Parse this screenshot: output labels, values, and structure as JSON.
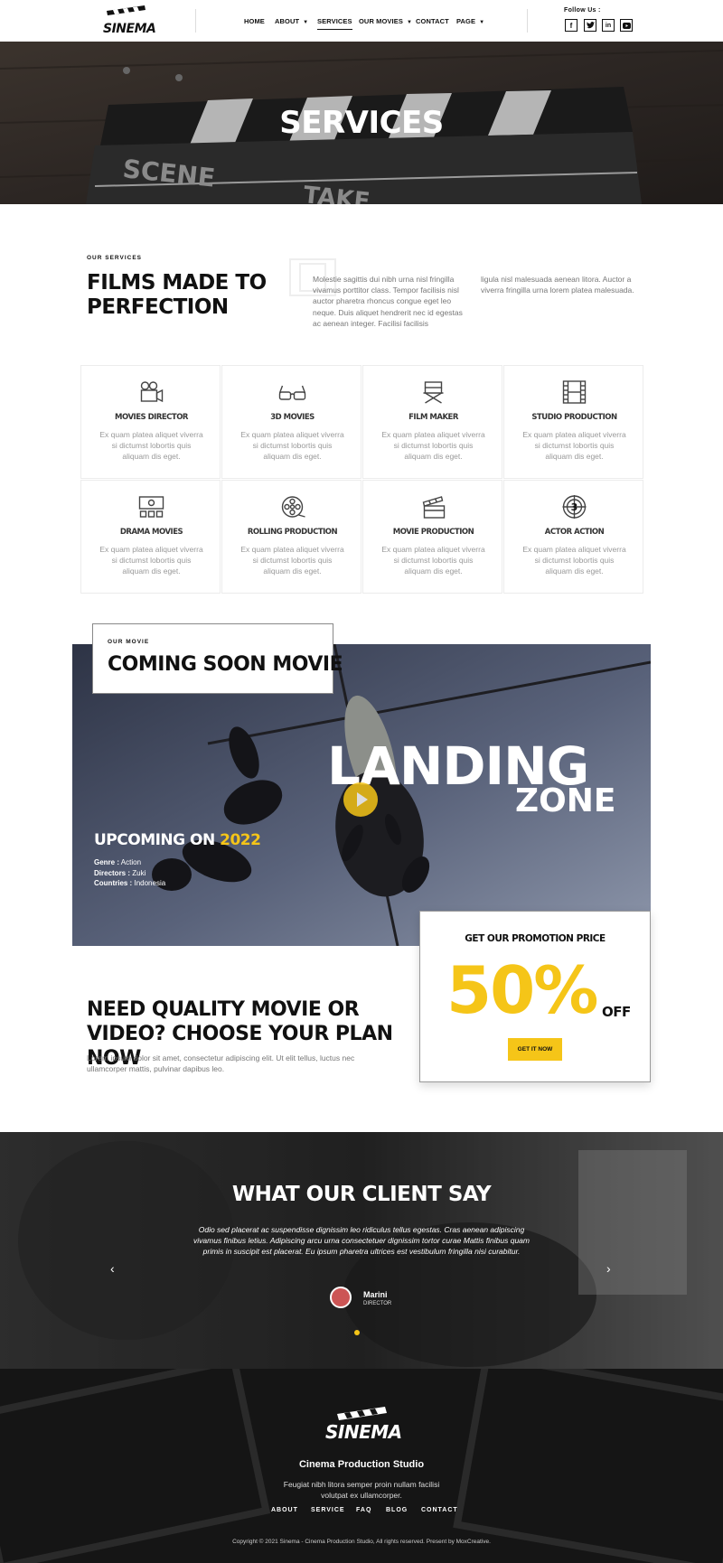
{
  "header": {
    "logo": "SINEMA",
    "nav": [
      {
        "label": "HOME"
      },
      {
        "label": "ABOUT"
      },
      {
        "label": "SERVICES"
      },
      {
        "label": "OUR MOVIES"
      },
      {
        "label": "CONTACT"
      },
      {
        "label": "PAGE"
      }
    ],
    "follow_label": "Follow Us :",
    "social": [
      "facebook-icon",
      "twitter-icon",
      "linkedin-icon",
      "youtube-icon"
    ]
  },
  "hero": {
    "title": "SERVICES"
  },
  "intro": {
    "tag": "OUR SERVICES",
    "title": "FILMS MADE TO PERFECTION",
    "p1": "Molestie sagittis dui nibh urna nisl fringilla vivamus porttitor class. Tempor facilisis nisl auctor pharetra rhoncus congue eget leo neque. Duis aliquet hendrerit nec id egestas ac aenean integer. Facilisi facilisis",
    "p2": "ligula nisl malesuada aenean litora. Auctor a viverra fringilla urna lorem platea malesuada."
  },
  "services": [
    {
      "title": "MOVIES DIRECTOR",
      "desc": "Ex quam platea aliquet viverra si dictumst lobortis quis aliquam dis eget.",
      "icon": "movie-camera-icon"
    },
    {
      "title": "3D MOVIES",
      "desc": "Ex quam platea aliquet viverra si dictumst lobortis quis aliquam dis eget.",
      "icon": "3d-glasses-icon"
    },
    {
      "title": "FILM MAKER",
      "desc": "Ex quam platea aliquet viverra si dictumst lobortis quis aliquam dis eget.",
      "icon": "director-chair-icon"
    },
    {
      "title": "STUDIO PRODUCTION",
      "desc": "Ex quam platea aliquet viverra si dictumst lobortis quis aliquam dis eget.",
      "icon": "film-strip-icon"
    },
    {
      "title": "DRAMA MOVIES",
      "desc": "Ex quam platea aliquet viverra si dictumst lobortis quis aliquam dis eget.",
      "icon": "cinema-screen-icon"
    },
    {
      "title": "ROLLING PRODUCTION",
      "desc": "Ex quam platea aliquet viverra si dictumst lobortis quis aliquam dis eget.",
      "icon": "film-reel-icon"
    },
    {
      "title": "MOVIE PRODUCTION",
      "desc": "Ex quam platea aliquet viverra si dictumst lobortis quis aliquam dis eget.",
      "icon": "clapperboard-icon"
    },
    {
      "title": "ACTOR ACTION",
      "desc": "Ex quam platea aliquet viverra si dictumst lobortis quis aliquam dis eget.",
      "icon": "countdown-icon"
    }
  ],
  "coming_soon": {
    "tag": "OUR MOVIE",
    "title": "COMING SOON MOVIE",
    "poster_title_1": "LANDING",
    "poster_title_2": "ZONE",
    "upcoming": "UPCOMING ON",
    "year": "2022",
    "genre_label": "Genre :",
    "genre": "Action",
    "directors_label": "Directors :",
    "directors": "Zuki",
    "countries_label": "Countries :",
    "countries": "Indonesia"
  },
  "promo": {
    "title": "GET OUR PROMOTION PRICE",
    "percent": "50%",
    "off": "OFF",
    "button": "GET IT NOW"
  },
  "plan": {
    "title": "NEED QUALITY MOVIE OR VIDEO? CHOOSE YOUR PLAN NOW",
    "text": "Lorem ipsum dolor sit amet, consectetur adipiscing elit. Ut elit tellus, luctus nec ullamcorper mattis, pulvinar dapibus leo."
  },
  "testimonial": {
    "title": "WHAT OUR CLIENT SAY",
    "quote": "Odio sed placerat ac suspendisse dignissim leo ridiculus tellus egestas. Cras aenean adipiscing vivamus finibus letius. Adipiscing arcu urna consectetuer dignissim tortor curae Mattis finibus quam primis in suscipit est placerat. Eu ipsum pharetra ultrices est vestibulum fringilla nisi curabitur.",
    "name": "Marini",
    "role": "DIRECTOR"
  },
  "footer": {
    "logo": "SINEMA",
    "studio": "Cinema Production Studio",
    "desc": "Feugiat nibh litora semper proin nullam facilisi volutpat ex ullamcorper.",
    "links": [
      "ABOUT",
      "SERVICE",
      "FAQ",
      "BLOG",
      "CONTACT"
    ],
    "copyright": "Copyright © 2021 Sinema - Cinema Production Studio, All rights reserved. Present by MoxCreative."
  },
  "colors": {
    "accent": "#f5c518",
    "dark": "#151515"
  }
}
